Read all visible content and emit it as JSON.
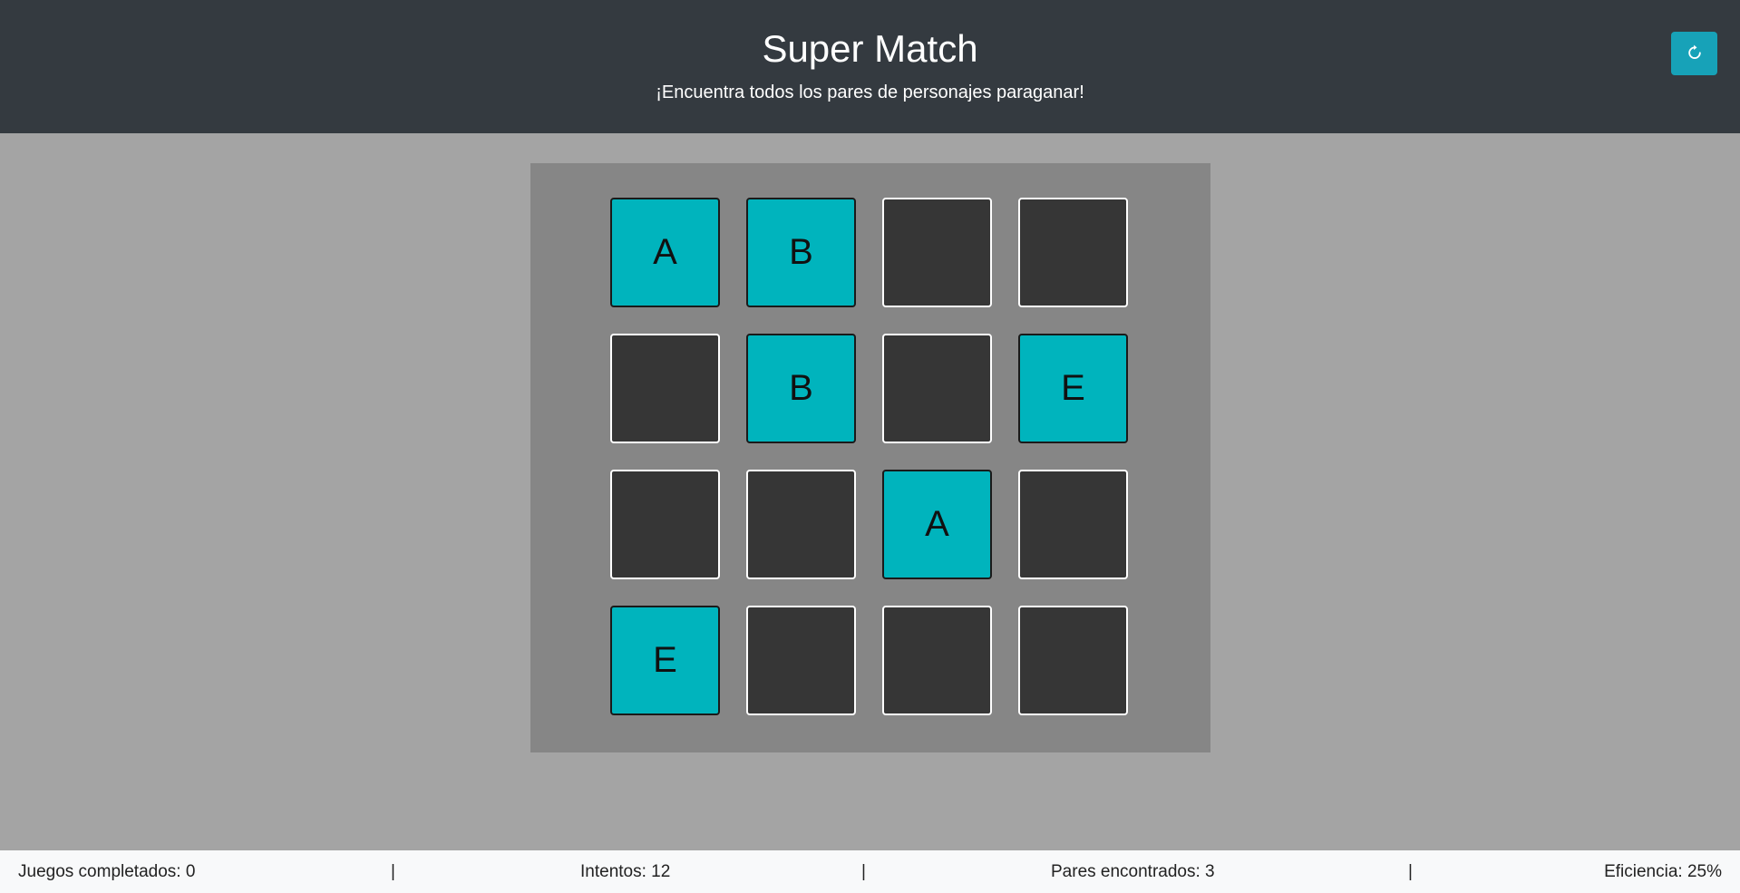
{
  "header": {
    "title": "Super Match",
    "subtitle": "¡Encuentra todos los pares de personajes paraganar!",
    "reset_icon": "refresh-icon"
  },
  "colors": {
    "header_bg": "#343a40",
    "accent": "#17a2b8",
    "card_revealed": "#00b4bd",
    "card_hidden": "#363636",
    "board_bg": "#868686",
    "page_bg": "#a4a4a4"
  },
  "board": {
    "rows": 4,
    "cols": 4,
    "cards": [
      {
        "state": "revealed",
        "letter": "A"
      },
      {
        "state": "revealed",
        "letter": "B"
      },
      {
        "state": "hidden",
        "letter": ""
      },
      {
        "state": "hidden",
        "letter": ""
      },
      {
        "state": "hidden",
        "letter": ""
      },
      {
        "state": "revealed",
        "letter": "B"
      },
      {
        "state": "hidden",
        "letter": ""
      },
      {
        "state": "revealed",
        "letter": "E"
      },
      {
        "state": "hidden",
        "letter": ""
      },
      {
        "state": "hidden",
        "letter": ""
      },
      {
        "state": "revealed",
        "letter": "A"
      },
      {
        "state": "hidden",
        "letter": ""
      },
      {
        "state": "revealed",
        "letter": "E"
      },
      {
        "state": "hidden",
        "letter": ""
      },
      {
        "state": "hidden",
        "letter": ""
      },
      {
        "state": "hidden",
        "letter": ""
      }
    ]
  },
  "footer": {
    "games_completed": "Juegos completados: 0",
    "separator": "|",
    "attempts": "Intentos: 12",
    "pairs_found": "Pares encontrados: 3",
    "efficiency": "Eficiencia: 25%"
  }
}
